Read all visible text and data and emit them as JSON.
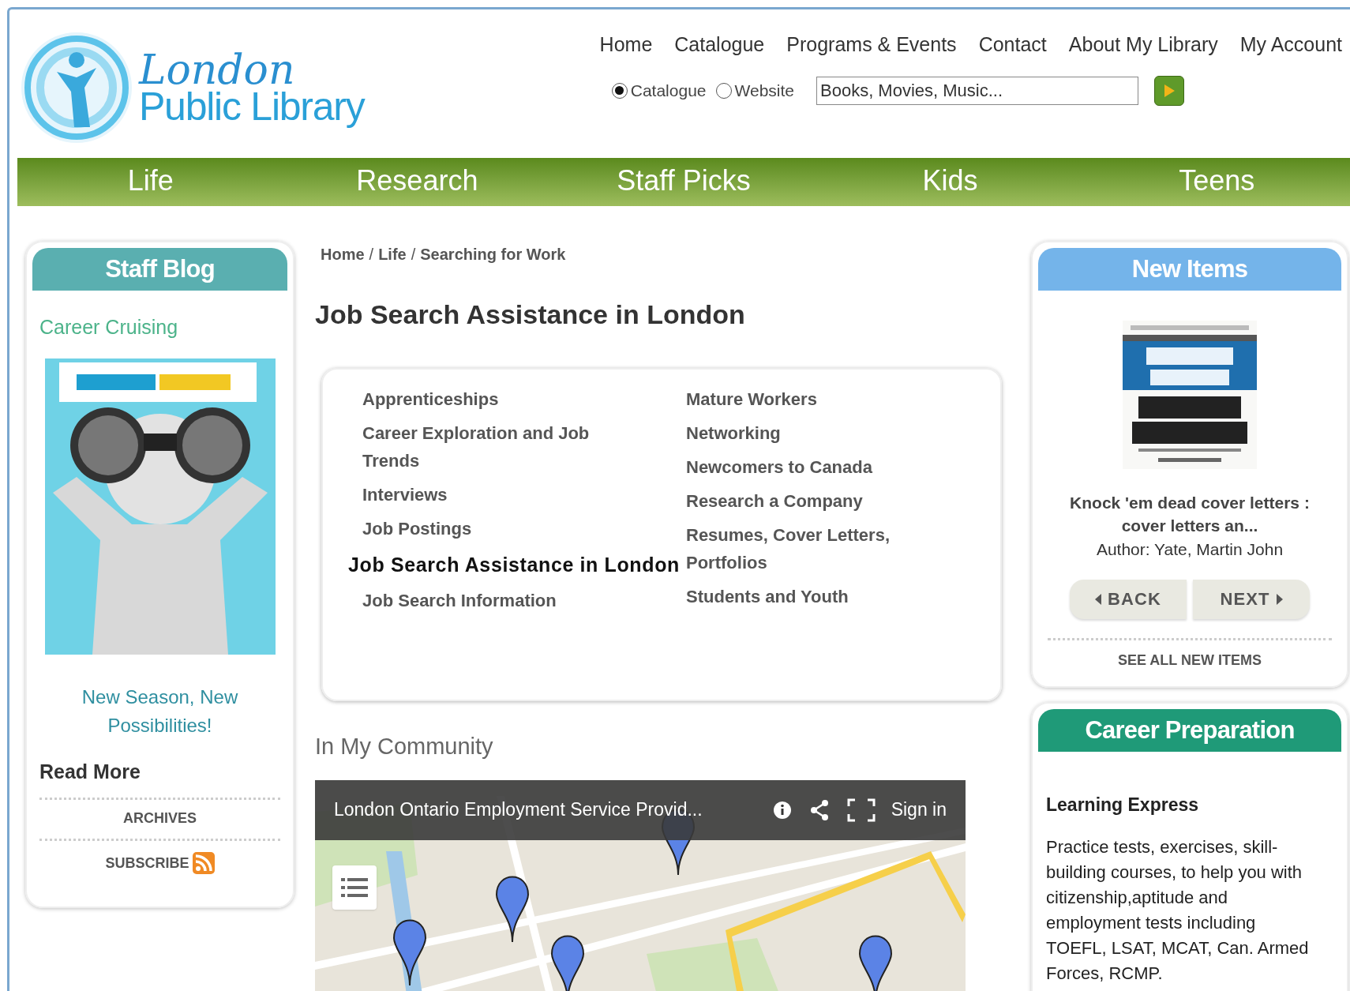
{
  "logo": {
    "line1": "London",
    "line2": "Public Library"
  },
  "top_nav": [
    "Home",
    "Catalogue",
    "Programs & Events",
    "Contact",
    "About My Library",
    "My Account"
  ],
  "search": {
    "scopes": [
      {
        "label": "Catalogue",
        "selected": true
      },
      {
        "label": "Website",
        "selected": false
      }
    ],
    "placeholder": "Books, Movies, Music..."
  },
  "main_nav": [
    "Life",
    "Research",
    "Staff Picks",
    "Kids",
    "Teens"
  ],
  "staff_blog": {
    "title": "Staff Blog",
    "post_title": "Career Cruising",
    "caption": "New Season, New Possibilities!",
    "read_more": "Read More",
    "archives": "ARCHIVES",
    "subscribe": "SUBSCRIBE"
  },
  "breadcrumb": {
    "separator": "/",
    "items": [
      "Home",
      "Life",
      "Searching for Work"
    ]
  },
  "page_title": "Job Search Assistance in London",
  "topics": [
    [
      {
        "label": "Apprenticeships",
        "selected": false
      },
      {
        "label": "Career Exploration and Job Trends",
        "selected": false
      },
      {
        "label": "Interviews",
        "selected": false
      },
      {
        "label": "Job Postings",
        "selected": false
      },
      {
        "label": "Job Search Assistance in London",
        "selected": true
      },
      {
        "label": "Job Search Information",
        "selected": false
      }
    ],
    [
      {
        "label": "Mature Workers",
        "selected": false
      },
      {
        "label": "Networking",
        "selected": false
      },
      {
        "label": "Newcomers to Canada",
        "selected": false
      },
      {
        "label": "Research a Company",
        "selected": false
      },
      {
        "label": "Resumes, Cover Letters, Portfolios",
        "selected": false
      },
      {
        "label": "Students and Youth",
        "selected": false
      }
    ]
  ],
  "community": {
    "heading": "In My Community",
    "map": {
      "title": "London Ontario Employment Service Provid...",
      "sign_in": "Sign in"
    }
  },
  "new_items": {
    "title": "New Items",
    "book": {
      "title": "Knock 'em dead cover letters : cover letters an...",
      "author": "Author: Yate, Martin John"
    },
    "back": "BACK",
    "next": "NEXT",
    "see_all": "SEE ALL NEW ITEMS"
  },
  "career_preparation": {
    "title": "Career Preparation",
    "resource": "Learning Express",
    "description": "Practice tests, exercises, skill-building courses, to help you with citizenship,aptitude and employment tests including TOEFL, LSAT, MCAT, Can. Armed Forces, RCMP."
  }
}
